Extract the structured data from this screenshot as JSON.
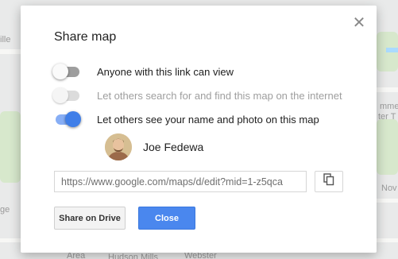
{
  "map": {
    "labels": [
      "ille",
      "ge",
      "Area",
      "Hudson Mills",
      "Webster",
      "mmer",
      "ter T",
      "Nov"
    ]
  },
  "dialog": {
    "title": "Share map",
    "close_icon": "close-icon",
    "options": [
      {
        "label": "Anyone with this link can view",
        "enabled": true,
        "on": false
      },
      {
        "label": "Let others search for and find this map on the internet",
        "enabled": false,
        "on": false
      },
      {
        "label": "Let others see your name and photo on this map",
        "enabled": true,
        "on": true
      }
    ],
    "user": {
      "name": "Joe Fedewa"
    },
    "link": {
      "value": "https://www.google.com/maps/d/edit?mid=1-z5qca"
    },
    "copy_icon": "copy-icon",
    "buttons": {
      "share_drive": "Share on Drive",
      "close": "Close"
    },
    "colors": {
      "accent": "#4a87ee",
      "toggle_on": "#3f7ee8"
    }
  }
}
